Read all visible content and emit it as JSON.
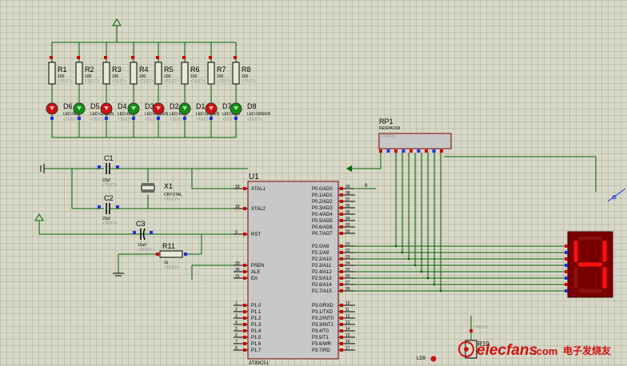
{
  "power": {
    "supply_arrow": "power-arrow",
    "ground": "ground-symbol"
  },
  "resistors": [
    {
      "ref": "R1",
      "value": "100"
    },
    {
      "ref": "R2",
      "value": "100"
    },
    {
      "ref": "R3",
      "value": "100"
    },
    {
      "ref": "R4",
      "value": "100"
    },
    {
      "ref": "R5",
      "value": "100"
    },
    {
      "ref": "R6",
      "value": "100"
    },
    {
      "ref": "R7",
      "value": "100"
    },
    {
      "ref": "R8",
      "value": "100"
    }
  ],
  "leds": [
    {
      "ref": "D6",
      "label": "LED-RED",
      "color": "#cc1010"
    },
    {
      "ref": "D5",
      "label": "LED-GREEN",
      "color": "#109010"
    },
    {
      "ref": "D4",
      "label": "LED-RED",
      "color": "#cc1010"
    },
    {
      "ref": "D3",
      "label": "LED-GREEN",
      "color": "#109010"
    },
    {
      "ref": "D2",
      "label": "LED-RED",
      "color": "#cc1010"
    },
    {
      "ref": "D1",
      "label": "LED-GREEN",
      "color": "#109010"
    },
    {
      "ref": "D7",
      "label": "LED-RED",
      "color": "#cc1010"
    },
    {
      "ref": "D8",
      "label": "LED-GREEN",
      "color": "#109010"
    }
  ],
  "text_placeholder": "<TEXT>",
  "c1": {
    "ref": "C1",
    "value": "22pf"
  },
  "c2": {
    "ref": "C2",
    "value": "22pf"
  },
  "c3": {
    "ref": "C3",
    "value": "10uF"
  },
  "x1": {
    "ref": "X1",
    "value": "CRYSTAL"
  },
  "r11": {
    "ref": "R11",
    "value": "1k"
  },
  "rp1": {
    "ref": "RP1",
    "value": "RESPACK8"
  },
  "u1": {
    "ref": "U1",
    "part": "AT89C51",
    "left_pins": [
      {
        "num": "19",
        "name": "XTAL1"
      },
      {
        "num": "18",
        "name": "XTAL2"
      },
      {
        "num": "9",
        "name": "RST"
      },
      {
        "num": "29",
        "name": "PSEN"
      },
      {
        "num": "30",
        "name": "ALE"
      },
      {
        "num": "31",
        "name": "EA"
      }
    ],
    "p1_pins": [
      {
        "num": "1",
        "name": "P1.0"
      },
      {
        "num": "2",
        "name": "P1.1"
      },
      {
        "num": "3",
        "name": "P1.2"
      },
      {
        "num": "4",
        "name": "P1.3"
      },
      {
        "num": "5",
        "name": "P1.4"
      },
      {
        "num": "6",
        "name": "P1.5"
      },
      {
        "num": "7",
        "name": "P1.6"
      },
      {
        "num": "8",
        "name": "P1.7"
      }
    ],
    "p0_pins": [
      {
        "num": "39",
        "name": "P0.0/AD0"
      },
      {
        "num": "38",
        "name": "P0.1/AD1"
      },
      {
        "num": "37",
        "name": "P0.2/AD2"
      },
      {
        "num": "36",
        "name": "P0.3/AD3"
      },
      {
        "num": "35",
        "name": "P0.4/AD4"
      },
      {
        "num": "34",
        "name": "P0.5/AD5"
      },
      {
        "num": "33",
        "name": "P0.6/AD6"
      },
      {
        "num": "32",
        "name": "P0.7/AD7"
      }
    ],
    "p2_pins": [
      {
        "num": "21",
        "name": "P2.0/A8"
      },
      {
        "num": "22",
        "name": "P2.1/A9"
      },
      {
        "num": "23",
        "name": "P2.2/A10"
      },
      {
        "num": "24",
        "name": "P2.3/A11"
      },
      {
        "num": "25",
        "name": "P2.4/A12"
      },
      {
        "num": "26",
        "name": "P2.5/A13"
      },
      {
        "num": "27",
        "name": "P2.6/A14"
      },
      {
        "num": "28",
        "name": "P2.7/A15"
      }
    ],
    "p3_pins": [
      {
        "num": "10",
        "name": "P3.0/RXD"
      },
      {
        "num": "11",
        "name": "P3.1/TXD"
      },
      {
        "num": "12",
        "name": "P3.2/INT0"
      },
      {
        "num": "13",
        "name": "P3.3/INT1"
      },
      {
        "num": "14",
        "name": "P3.4/T0"
      },
      {
        "num": "15",
        "name": "P3.5/T1"
      },
      {
        "num": "16",
        "name": "P3.6/WR"
      },
      {
        "num": "17",
        "name": "P3.7/RD"
      }
    ]
  },
  "net_label_9": "9",
  "seven_seg": {
    "digit": "4",
    "color": "#ff1010",
    "bg": "#7a0000"
  },
  "r10": {
    "ref": "R10"
  },
  "bottom_partial": "LD9",
  "watermark": {
    "site": "elecfans",
    "com": ".com",
    "cn": "电子发烧友",
    "color": "#d01010"
  }
}
